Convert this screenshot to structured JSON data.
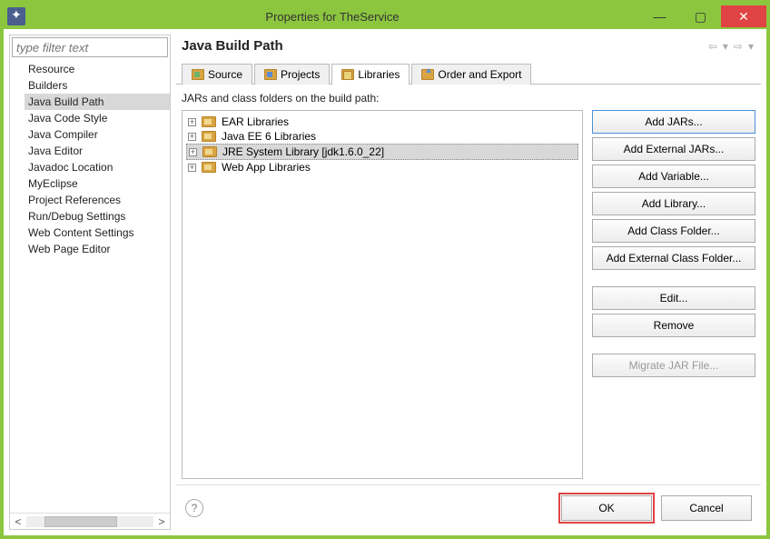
{
  "window": {
    "title": "Properties for TheService"
  },
  "sidebar": {
    "filter_placeholder": "type filter text",
    "items": [
      "Resource",
      "Builders",
      "Java Build Path",
      "Java Code Style",
      "Java Compiler",
      "Java Editor",
      "Javadoc Location",
      "MyEclipse",
      "Project References",
      "Run/Debug Settings",
      "Web Content Settings",
      "Web Page Editor"
    ],
    "selected_index": 2
  },
  "header": {
    "title": "Java Build Path"
  },
  "tabs": {
    "items": [
      {
        "label": "Source"
      },
      {
        "label": "Projects"
      },
      {
        "label": "Libraries"
      },
      {
        "label": "Order and Export"
      }
    ],
    "active_index": 2
  },
  "libraries": {
    "description": "JARs and class folders on the build path:",
    "items": [
      "EAR Libraries",
      "Java EE 6 Libraries",
      "JRE System Library [jdk1.6.0_22]",
      "Web App Libraries"
    ],
    "selected_index": 2
  },
  "buttons": {
    "add_jars": "Add JARs...",
    "add_ext_jars": "Add External JARs...",
    "add_variable": "Add Variable...",
    "add_library": "Add Library...",
    "add_class_folder": "Add Class Folder...",
    "add_ext_class_folder": "Add External Class Folder...",
    "edit": "Edit...",
    "remove": "Remove",
    "migrate": "Migrate JAR File..."
  },
  "footer": {
    "ok": "OK",
    "cancel": "Cancel"
  }
}
